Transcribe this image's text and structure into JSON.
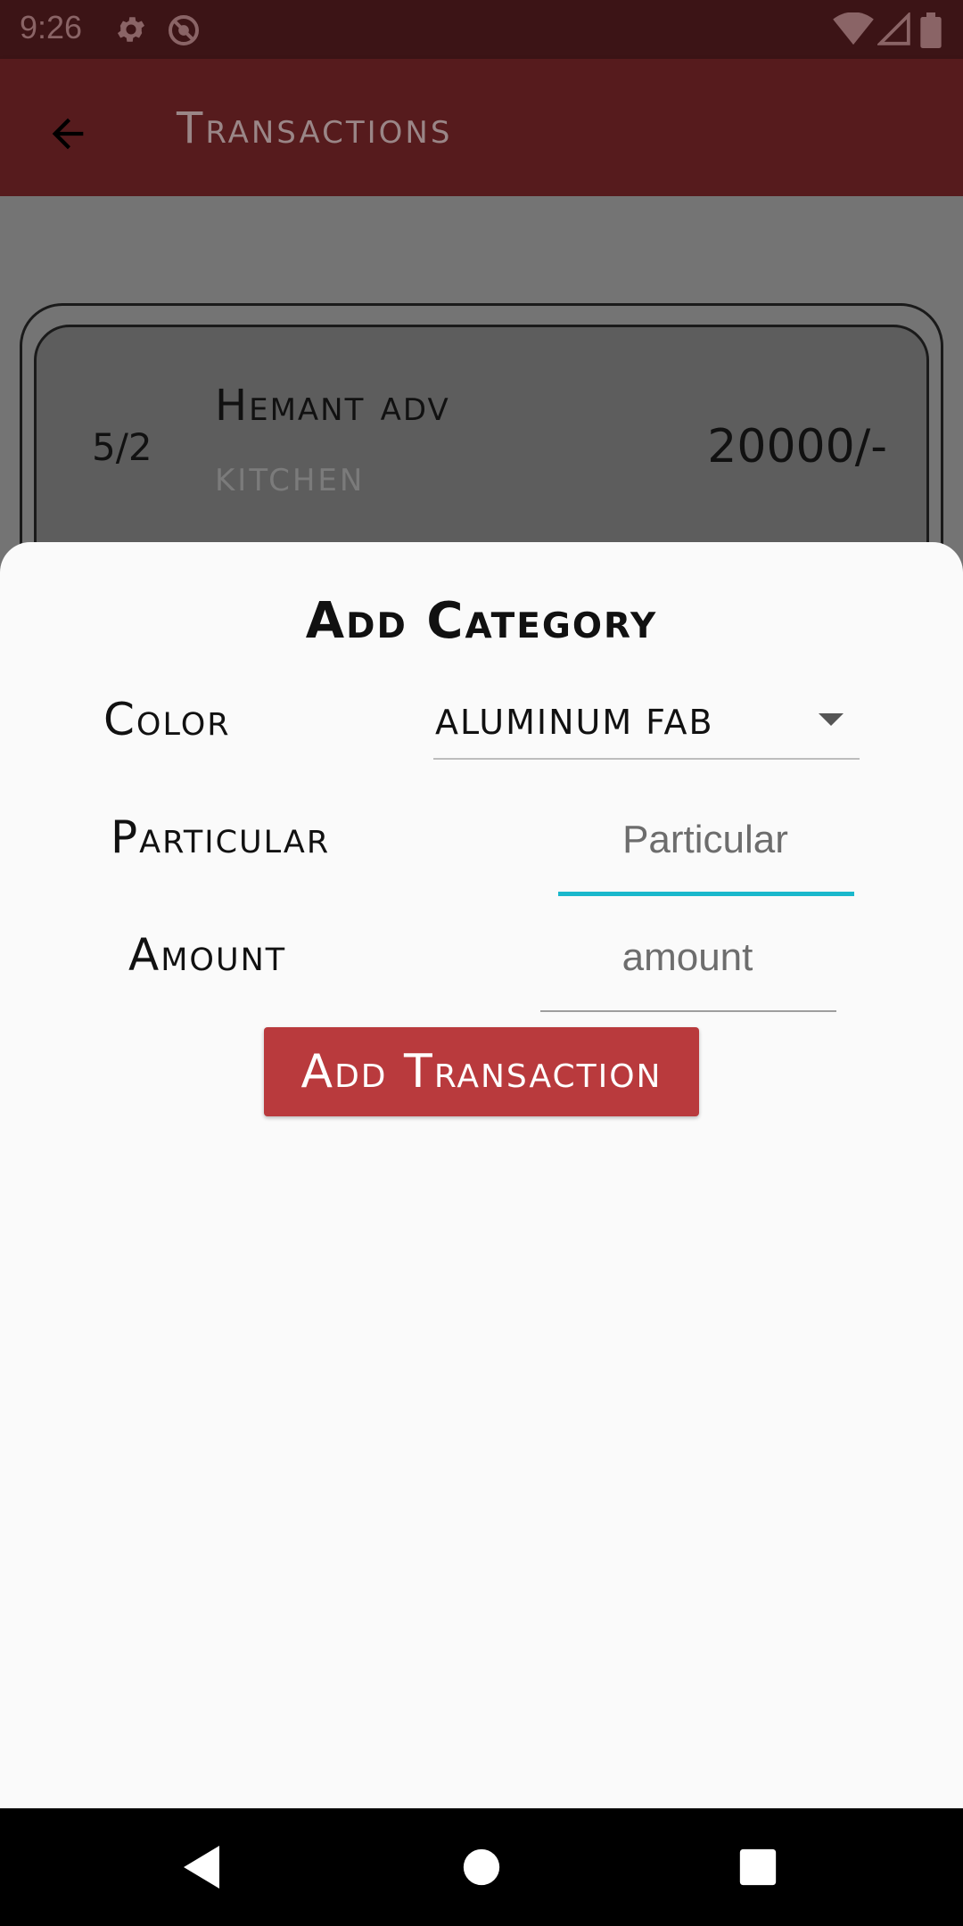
{
  "status_bar": {
    "time": "9:26",
    "icons": [
      "gear-icon",
      "do-not-disturb-icon",
      "wifi-icon",
      "signal-icon",
      "battery-icon"
    ]
  },
  "app_bar": {
    "title": "Transactions",
    "back_icon": "arrow-back-icon"
  },
  "transaction_card": {
    "date": "5/2",
    "name": "Hemant adv",
    "category": "KITCHEN",
    "amount": "20000/-"
  },
  "sheet": {
    "title": "Add Category",
    "color_label": "Color",
    "color_value": "ALUMINUM FAB",
    "particular_label": "Particular",
    "particular_placeholder": "Particular",
    "amount_label": "Amount",
    "amount_placeholder": "amount",
    "submit_label": "Add Transaction"
  },
  "colors": {
    "status_bar": "#3c1416",
    "app_bar": "#561b1d",
    "button": "#b93a3d",
    "focus_line": "#1ab8cc",
    "sheet": "#fafafa"
  },
  "nav_bar": {
    "icons": [
      "back-triangle-icon",
      "home-circle-icon",
      "recents-square-icon"
    ]
  }
}
